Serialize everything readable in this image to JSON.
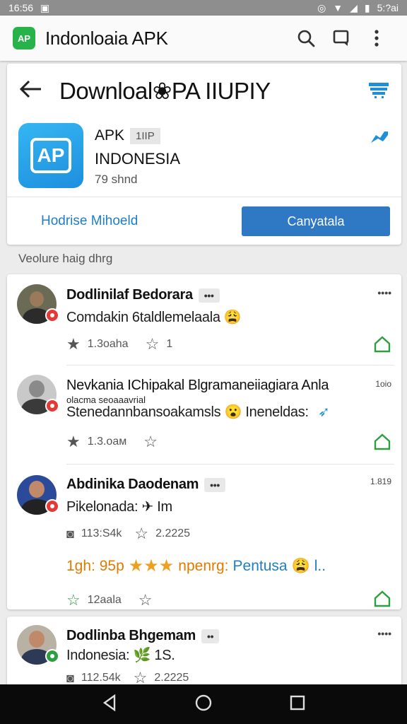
{
  "status_bar": {
    "time": "16:56",
    "clock_right": "5:?ai"
  },
  "app_bar": {
    "logo_text": "AP",
    "title": "Indonloaia APK"
  },
  "detail": {
    "page_title": "Downloal❀PA IIUPIY",
    "apk_label": "APK",
    "version": "1IIP",
    "app_name": "INDONESIA",
    "app_size": "79 shnd",
    "icon_text": "AP",
    "secondary_link": "Hodrise Mihoeld",
    "primary_button": "Canyatala"
  },
  "section_label": "Veolure haig dhrg",
  "reviews": [
    {
      "name": "Dodlinilaf Bedorara",
      "chip": "•••",
      "text": "Comdakin 6taldlemelaala 😩",
      "stat1": "1.3oaha",
      "stat2": "1",
      "aux": "••••",
      "badge_color": "#e53935"
    },
    {
      "name": "Nevkania IChipakal Blgramaneiiagiara Anla",
      "note": "olacma seoaaavrial",
      "text": "Stenedannbansoakamsls 😮  Ineneldas:",
      "stat1": "1.3.oaм",
      "aux": "1oio",
      "badge_color": "#e53935"
    },
    {
      "name": "Abdinika Daodenam",
      "chip": "•••",
      "text": "Pikelonada: ✈ Im",
      "stat1": "113:S4k",
      "stat2": "2.2225",
      "promo_prefix": "1gh: 95p",
      "promo_mid": "npenrg:",
      "promo_suffix": "Pentusa",
      "promo_end": "l..",
      "stat3": "12aala",
      "aux": "1.819",
      "badge_color": "#e53935"
    },
    {
      "name": "Dodlinba Bhgemam",
      "chip": "••",
      "text": "Indonesia: 🌿 1S.",
      "stat1": "112.54k",
      "stat2": "2.2225",
      "aux": "••••",
      "badge_color": "#2e9e3f"
    }
  ],
  "colors": {
    "accent": "#2e78c4",
    "link": "#1f7ec1",
    "green": "#2e9e3f",
    "star": "#f0a020"
  },
  "icons": [
    "back-arrow-icon",
    "search-icon",
    "chat-icon",
    "more-vert-icon",
    "cart-icon",
    "share-icon",
    "star-icon",
    "home-icon",
    "nav-back-icon",
    "nav-home-icon",
    "nav-recents-icon"
  ]
}
